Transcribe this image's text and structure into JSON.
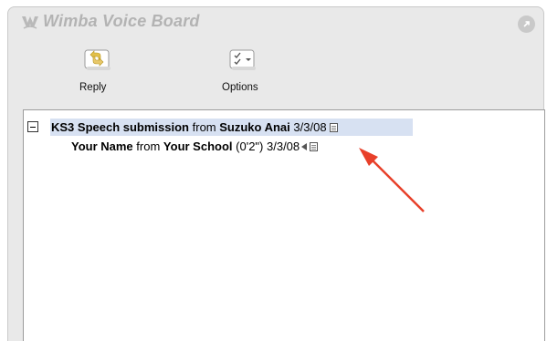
{
  "window": {
    "title": "Wimba Voice Board"
  },
  "toolbar": {
    "reply_label": "Reply",
    "options_label": "Options"
  },
  "messages": [
    {
      "subject": "KS3 Speech submission",
      "from_word": "from",
      "author": "Suzuko Anai",
      "date": "3/3/08",
      "expanded": true,
      "selected": true
    },
    {
      "subject": "Your Name",
      "from_word": "from",
      "author": "Your School",
      "duration": "(0'2\")",
      "date": "3/3/08"
    }
  ],
  "icons": {
    "logo": "wimba-logo-icon",
    "expand": "expand-icon",
    "reply": "reply-icon",
    "options": "options-icon",
    "collapse": "collapse-icon",
    "play": "play-icon",
    "document": "document-icon"
  },
  "colors": {
    "panel_bg": "#e9e9e9",
    "title_text": "#b3b3b3",
    "selection": "#d7e1f2",
    "annotation_arrow": "#e8402a"
  }
}
